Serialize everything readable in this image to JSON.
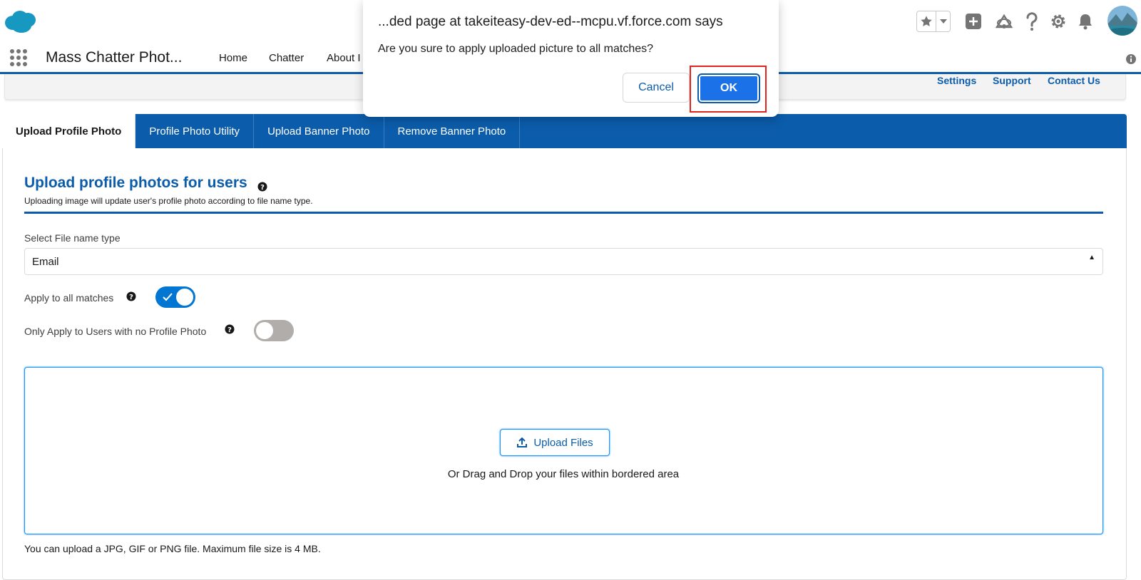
{
  "header": {
    "icons": [
      "salesforce-cloud-logo",
      "star-icon",
      "chevron-down-icon",
      "plus-icon",
      "trailhead-icon",
      "help-icon",
      "gear-icon",
      "bell-icon",
      "avatar"
    ]
  },
  "app_nav": {
    "app_name": "Mass Chatter Phot...",
    "items": [
      "Home",
      "Chatter",
      "About I"
    ]
  },
  "utility_links": [
    "Settings",
    "Support",
    "Contact Us"
  ],
  "tabs": [
    {
      "label": "Upload Profile Photo",
      "active": true
    },
    {
      "label": "Profile Photo Utility",
      "active": false
    },
    {
      "label": "Upload Banner Photo",
      "active": false
    },
    {
      "label": "Remove Banner Photo",
      "active": false
    }
  ],
  "section": {
    "title": "Upload profile photos for users",
    "subtitle": "Uploading image will update user's profile photo according to file name type."
  },
  "form": {
    "select_label": "Select File name type",
    "select_value": "Email",
    "apply_all_label": "Apply to all matches",
    "apply_all_on": true,
    "only_no_photo_label": "Only Apply to Users with no Profile Photo",
    "only_no_photo_on": false
  },
  "upload": {
    "button_label": "Upload Files",
    "drop_text": "Or Drag and Drop your files within bordered area",
    "hint": "You can upload a JPG, GIF or PNG file. Maximum file size is 4 MB."
  },
  "dialog": {
    "title": "...ded page at takeiteasy-dev-ed--mcpu.vf.force.com says",
    "message": "Are you sure to apply uploaded picture to all matches?",
    "cancel_label": "Cancel",
    "ok_label": "OK"
  },
  "colors": {
    "brand_blue": "#0b5cab",
    "toggle_on": "#0176d3",
    "ok_button": "#1b72e8",
    "highlight_red": "#e3241a"
  }
}
